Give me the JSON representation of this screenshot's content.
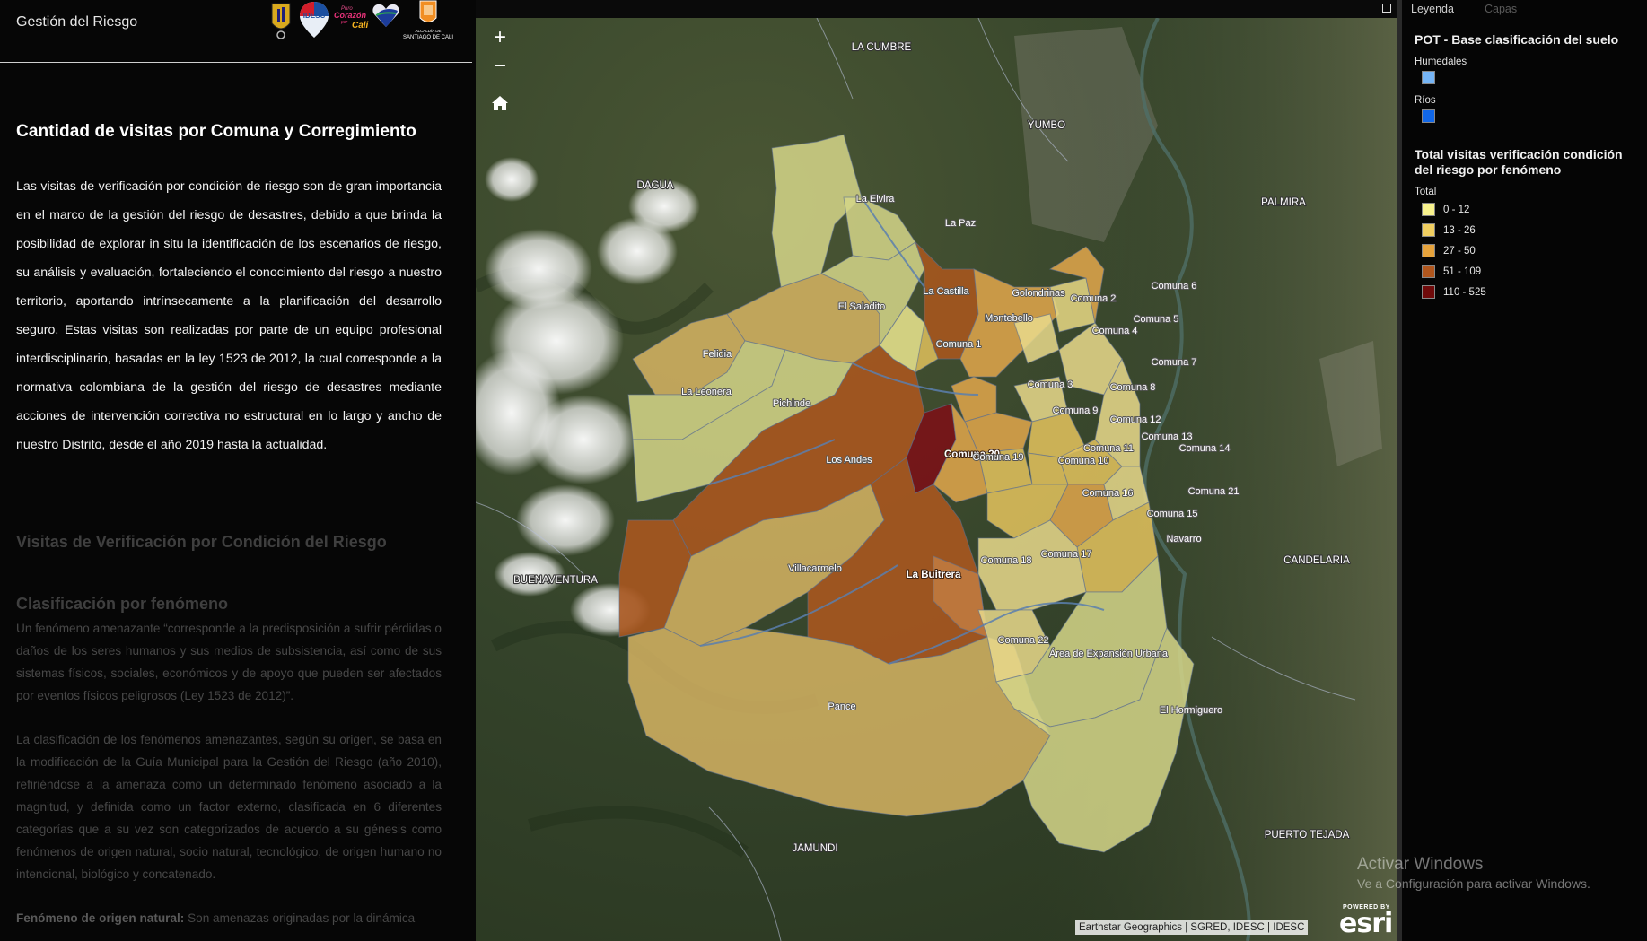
{
  "app": {
    "title": "Gestión del Riesgo",
    "logos": [
      "shield-logo",
      "idesc-logo",
      "corazon-cali-logo",
      "heart-logo",
      "alcaldia-santiago-de-cali-logo"
    ],
    "logo_texts": {
      "idesc": "IDESC",
      "corazon_1": "Puro",
      "corazon_2": "Corazón",
      "corazon_3": "por",
      "corazon_4": "Cali",
      "alcaldia_1": "ALCALDÍA DE",
      "alcaldia_2": "SANTIAGO DE CALI"
    }
  },
  "story": {
    "title": "Cantidad de visitas por Comuna y Corregimiento",
    "body": "Las visitas de verificación por condición de riesgo son de gran importancia en el marco de la gestión del riesgo de desastres, debido a que brinda la posibilidad de explorar in situ la identificación de los escenarios de riesgo, su análisis y evaluación, fortaleciendo el conocimiento del riesgo a nuestro territorio, aportando intrínsecamente a la planificación del desarrollo seguro. Estas visitas son realizadas por parte de un equipo profesional interdisciplinario, basadas en la ley 1523 de 2012, la cual corresponde a la normativa colombiana de la gestión del riesgo de desastres mediante acciones de intervención correctiva no estructural en lo largo y ancho de nuestro Distrito, desde el año 2019 hasta la actualidad.",
    "next_title": "Visitas de Verificación por Condición del Riesgo",
    "next_subtitle": "Clasificación por fenómeno",
    "next_para_1": "Un fenómeno amenazante “corresponde a la predisposición a sufrir pérdidas o daños de los seres humanos y sus medios de subsistencia, así como de sus sistemas físicos, sociales, económicos y de apoyo que pueden ser afectados por eventos físicos peligrosos (Ley 1523 de 2012)”.",
    "next_para_2": "La clasificación de los fenómenos amenazantes, según su origen, se basa en la modificación de la Guía Municipal para la Gestión del Riesgo (año 2010), refiriéndose a la amenaza como un determinado fenómeno asociado a la magnitud, y definida como un factor externo, clasificada en 6 diferentes categorías que a su vez son categorizados de acuerdo a su génesis como fenómenos de origen natural, socio natural, tecnológico, de origen humano no intencional, biológico y concatenado.",
    "next_para_3_bold": "Fenómeno de origen natural:",
    "next_para_3": " Son amenazas originadas por la dinámica"
  },
  "map": {
    "controls": {
      "zoom_in": "+",
      "zoom_out": "−",
      "home": "home-icon",
      "expand": "expand-icon"
    },
    "attribution": "Earthstar Geographics | SGRED, IDESC | IDESC",
    "esri_powered": "POWERED BY",
    "esri_word": "esri",
    "place_labels": [
      "LA CUMBRE",
      "YUMBO",
      "DAGUA",
      "PALMIRA",
      "BUENAVENTURA",
      "CANDELARIA",
      "JAMUNDI",
      "PUERTO TEJADA"
    ],
    "region_labels": [
      "La Elvira",
      "La Paz",
      "La Castilla",
      "El Saladito",
      "Golondrinas",
      "Montebello",
      "Comuna 1",
      "Felidia",
      "La Leonera",
      "Pichinde",
      "Los Andes",
      "Comuna 20",
      "Comuna 2",
      "Comuna 3",
      "Comuna 4",
      "Comuna 5",
      "Comuna 6",
      "Comuna 7",
      "Comuna 8",
      "Comuna 9",
      "Comuna 10",
      "Comuna 11",
      "Comuna 12",
      "Comuna 13",
      "Comuna 14",
      "Comuna 15",
      "Comuna 16",
      "Comuna 17",
      "Comuna 18",
      "Comuna 19",
      "Comuna 21",
      "Comuna 22",
      "Navarro",
      "Villacarmelo",
      "La Buitrera",
      "Pance",
      "Área de Expansión Urbana",
      "El Hormiguero"
    ],
    "colors": {
      "c0": "#d9d88a",
      "c1": "#e3c25d",
      "c2": "#dda44b",
      "c3": "#a5561f",
      "c4": "#7a0c12",
      "river": "#5a7fae"
    }
  },
  "legend": {
    "tabs": [
      "Leyenda",
      "Capas"
    ],
    "layer1": {
      "title": "POT - Base clasificación del suelo",
      "items": [
        {
          "label": "Humedales",
          "color": "#76b5f5"
        },
        {
          "label": "Ríos",
          "color": "#1167e8"
        }
      ]
    },
    "layer2": {
      "title": "Total visitas verificación condición del riesgo por fenómeno",
      "field": "Total",
      "classes": [
        {
          "label": "0 - 12",
          "color": "#f8f28c"
        },
        {
          "label": "13 - 26",
          "color": "#f1cf61"
        },
        {
          "label": "27 - 50",
          "color": "#e6a33c"
        },
        {
          "label": "51 - 109",
          "color": "#b0561d"
        },
        {
          "label": "110 - 525",
          "color": "#6f0a0a"
        }
      ]
    }
  },
  "watermark": {
    "title": "Activar Windows",
    "subtitle": "Ve a Configuración para activar Windows."
  }
}
